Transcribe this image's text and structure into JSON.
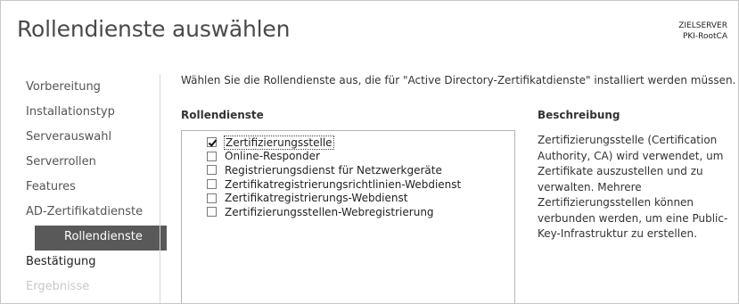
{
  "header": {
    "title": "Rollendienste auswählen",
    "target_label": "ZIELSERVER",
    "target_name": "PKI-RootCA"
  },
  "nav": {
    "items": [
      {
        "label": "Vorbereitung"
      },
      {
        "label": "Installationstyp"
      },
      {
        "label": "Serverauswahl"
      },
      {
        "label": "Serverrollen"
      },
      {
        "label": "Features"
      },
      {
        "label": "AD-Zertifikatdienste"
      },
      {
        "label": "Rollendienste"
      },
      {
        "label": "Bestätigung"
      },
      {
        "label": "Ergebnisse"
      }
    ]
  },
  "main": {
    "intro": "Wählen Sie die Rollendienste aus, die für \"Active Directory-Zertifikatdienste\" installiert werden müssen.",
    "roles_heading": "Rollendienste",
    "description_heading": "Beschreibung",
    "roles": [
      {
        "label": "Zertifizierungsstelle",
        "checked": true
      },
      {
        "label": "Online-Responder",
        "checked": false
      },
      {
        "label": "Registrierungsdienst für Netzwerkgeräte",
        "checked": false
      },
      {
        "label": "Zertifikatregistrierungsrichtlinien-Webdienst",
        "checked": false
      },
      {
        "label": "Zertifikatregistrierungs-Webdienst",
        "checked": false
      },
      {
        "label": "Zertifizierungsstellen-Webregistrierung",
        "checked": false
      }
    ],
    "description": "Zertifizierungsstelle (Certification Authority, CA) wird verwendet, um Zertifikate auszustellen und zu verwalten. Mehrere Zertifizierungsstellen können verbunden werden, um eine Public-Key-Infrastruktur zu erstellen."
  }
}
